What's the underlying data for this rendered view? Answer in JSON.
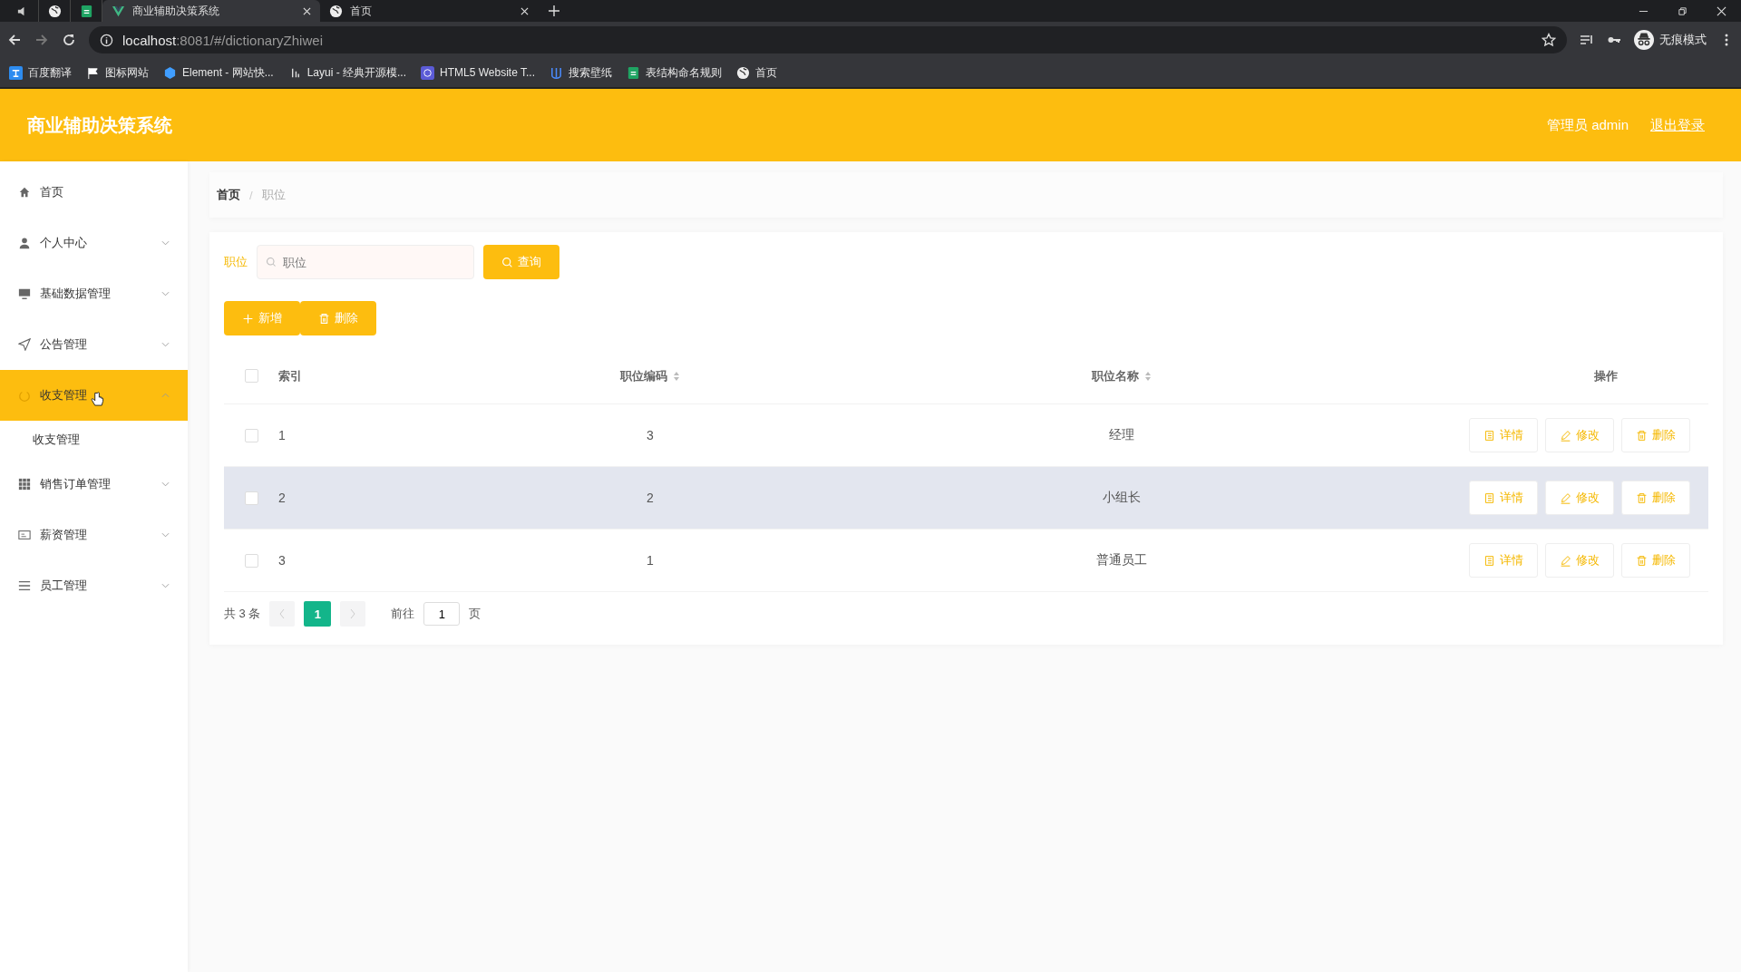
{
  "browser": {
    "tabs": [
      {
        "kind": "pinned",
        "selected": false
      },
      {
        "kind": "pinned",
        "selected": false
      },
      {
        "kind": "pinned",
        "selected": false
      },
      {
        "kind": "page",
        "title": "商业辅助决策系统",
        "selected": true
      },
      {
        "kind": "page",
        "title": "首页",
        "selected": false
      }
    ],
    "url_host": "localhost",
    "url_rest": ":8081/#/dictionaryZhiwei",
    "profile": "无痕模式",
    "bookmarks": [
      {
        "label": "百度翻译"
      },
      {
        "label": "图标网站"
      },
      {
        "label": "Element - 网站快..."
      },
      {
        "label": "Layui - 经典开源模..."
      },
      {
        "label": "HTML5 Website T..."
      },
      {
        "label": "搜索壁纸"
      },
      {
        "label": "表结构命名规则"
      },
      {
        "label": "首页"
      }
    ]
  },
  "header": {
    "title": "商业辅助决策系统",
    "user": "管理员 admin",
    "logout": "退出登录"
  },
  "sidebar": {
    "items": [
      {
        "label": "首页",
        "expandable": false,
        "expanded": false,
        "selected": false
      },
      {
        "label": "个人中心",
        "expandable": true,
        "expanded": false,
        "selected": false
      },
      {
        "label": "基础数据管理",
        "expandable": true,
        "expanded": false,
        "selected": false
      },
      {
        "label": "公告管理",
        "expandable": true,
        "expanded": false,
        "selected": false
      },
      {
        "label": "收支管理",
        "expandable": true,
        "expanded": true,
        "selected": true,
        "children": [
          {
            "label": "收支管理"
          }
        ]
      },
      {
        "label": "销售订单管理",
        "expandable": true,
        "expanded": false,
        "selected": false
      },
      {
        "label": "薪资管理",
        "expandable": true,
        "expanded": false,
        "selected": false
      },
      {
        "label": "员工管理",
        "expandable": true,
        "expanded": false,
        "selected": false
      }
    ]
  },
  "breadcrumb": {
    "items": [
      "首页",
      "职位"
    ],
    "separator": "/"
  },
  "search": {
    "label": "职位",
    "placeholder": "职位",
    "button": "查询"
  },
  "actions": [
    {
      "kind": "add",
      "label": "新增"
    },
    {
      "kind": "delete",
      "label": "删除"
    }
  ],
  "table": {
    "columns": [
      {
        "label": "索引",
        "sortable": false
      },
      {
        "label": "职位编码",
        "sortable": true
      },
      {
        "label": "职位名称",
        "sortable": true
      },
      {
        "label": "操作",
        "sortable": false
      }
    ],
    "header_checked": false,
    "rows": [
      {
        "index": "1",
        "code": "3",
        "name": "经理",
        "checked": false,
        "highlighted": false,
        "actions": [
          {
            "kind": "detail",
            "label": "详情"
          },
          {
            "kind": "edit",
            "label": "修改"
          },
          {
            "kind": "delete",
            "label": "删除"
          }
        ]
      },
      {
        "index": "2",
        "code": "2",
        "name": "小组长",
        "checked": false,
        "highlighted": true,
        "actions": [
          {
            "kind": "detail",
            "label": "详情"
          },
          {
            "kind": "edit",
            "label": "修改"
          },
          {
            "kind": "delete",
            "label": "删除"
          }
        ]
      },
      {
        "index": "3",
        "code": "1",
        "name": "普通员工",
        "checked": false,
        "highlighted": false,
        "actions": [
          {
            "kind": "detail",
            "label": "详情"
          },
          {
            "kind": "edit",
            "label": "修改"
          },
          {
            "kind": "delete",
            "label": "删除"
          }
        ]
      }
    ]
  },
  "pagination": {
    "total": "共 3 条",
    "pages": [
      {
        "label": "1",
        "selected": true
      }
    ],
    "goto": "前往",
    "page_input": "1",
    "suffix": "页"
  }
}
